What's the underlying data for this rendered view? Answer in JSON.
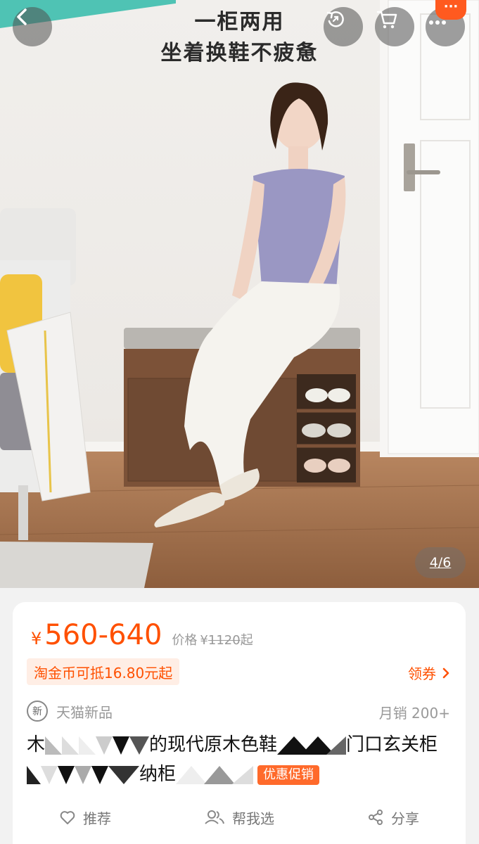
{
  "hero": {
    "slogan_line1": "一柜两用",
    "slogan_line2": "坐着换鞋不疲惫",
    "page_indicator": "4/6",
    "more_badge": "···"
  },
  "topbar": {
    "back_icon": "chevron-left-icon",
    "share_icon": "refresh-share-icon",
    "cart_icon": "cart-icon",
    "more_icon": "more-dots-icon"
  },
  "price": {
    "currency": "¥",
    "range": "560-640",
    "orig_label": "价格",
    "orig_currency": "¥",
    "orig_value": "1120",
    "orig_suffix": "起"
  },
  "coin_tag": "淘金币可抵16.80元起",
  "coupon": {
    "label": "领券",
    "icon": "chevron-right-icon"
  },
  "brand": {
    "badge": "新",
    "label": "天猫新品"
  },
  "sales": "月销 200+",
  "title": {
    "line1_a": "木",
    "line1_b": "的现代原木色鞋",
    "line1_c": "门口玄关柜",
    "line2_b": "纳柜",
    "promo": "优惠促销"
  },
  "actions": [
    {
      "label": "推荐",
      "icon": "heart-icon"
    },
    {
      "label": "帮我选",
      "icon": "people-icon"
    },
    {
      "label": "分享",
      "icon": "share-icon"
    }
  ],
  "colors": {
    "accent": "#ff5000",
    "promo": "#ff6a2b",
    "teal": "#4fc3b4"
  }
}
